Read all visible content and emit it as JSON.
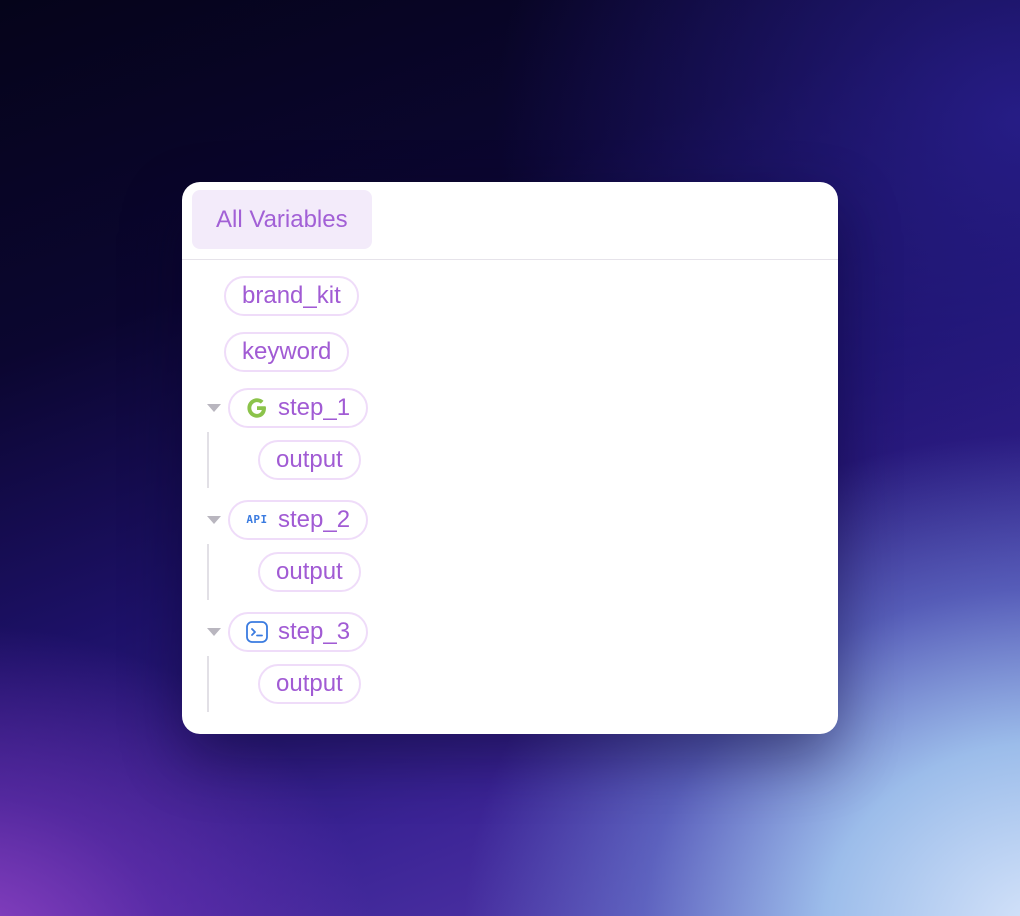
{
  "tab": {
    "label": "All Variables"
  },
  "variables": [
    {
      "name": "brand_kit"
    },
    {
      "name": "keyword"
    }
  ],
  "steps": [
    {
      "name": "step_1",
      "icon": "google-icon",
      "icon_color": "#8bc34a",
      "children": [
        {
          "name": "output"
        }
      ]
    },
    {
      "name": "step_2",
      "icon": "api-icon",
      "icon_text": "API",
      "icon_color": "#3a7be0",
      "children": [
        {
          "name": "output"
        }
      ]
    },
    {
      "name": "step_3",
      "icon": "terminal-icon",
      "icon_color": "#3a7be0",
      "children": [
        {
          "name": "output"
        }
      ]
    }
  ],
  "colors": {
    "accent_text": "#a15bd4",
    "chip_border": "#efdcf9",
    "tab_bg": "#f3ebfa"
  }
}
